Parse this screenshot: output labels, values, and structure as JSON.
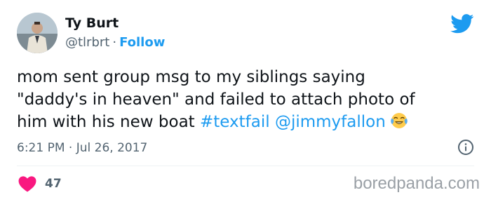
{
  "author": {
    "name": "Ty Burt",
    "handle": "@tlrbrt",
    "separator": "·",
    "follow_label": "Follow"
  },
  "tweet": {
    "text_line_1": "mom sent group msg to my siblings saying",
    "text_line_2": "\"daddy's in heaven\" and failed to attach photo of",
    "text_line_3": "him with his new boat",
    "hashtag": "#textfail",
    "mention": "@jimmyfallon",
    "emoji": "face-with-tears-of-joy",
    "timestamp": "6:21 PM · Jul 26, 2017"
  },
  "engagement": {
    "likes": "47"
  },
  "watermark": "boredpanda.com",
  "colors": {
    "link": "#1d9bf0",
    "secondary_text": "#536471",
    "like_heart": "#f91880",
    "twitter_blue": "#1d9bf0"
  }
}
